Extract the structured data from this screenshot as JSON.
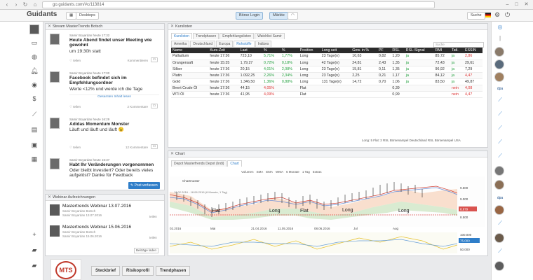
{
  "browser": {
    "url": "go.guidants.com/#c/113814"
  },
  "topbar": {
    "logo": "Guidants",
    "desktop_label": "Desktops",
    "btn_login": "Börse Login",
    "btn_market": "Märkte",
    "search": "Suche"
  },
  "stream": {
    "title": "Stream MasterTrends Botsch",
    "posts": [
      {
        "author": "Samir Boyardan",
        "time": "heute 17:32",
        "title": "Heute Abend findet unser Meeting wie gewohnt",
        "body": "um 19:30h statt",
        "like": "teilen",
        "comments": "Kommentieren"
      },
      {
        "author": "Samir Boyardan",
        "time": "heute 17:00",
        "title": "Facebook befindet sich im Empfehlungsordner",
        "body": "Werte <12% und werde ich die Tage",
        "read": "Gesamten Inhalt lesen",
        "like": "teilen",
        "comments": "2 Kommentare"
      },
      {
        "author": "Samir Boyardan",
        "time": "heute 16:29",
        "title": "Adidas Momentum Monster",
        "body": "Läuft und läuft und läuft 😉",
        "like": "teilen",
        "comments": "12 Kommentare"
      },
      {
        "author": "Samir Boyardan",
        "time": "heute 15:37",
        "title": "Habt Ihr Veränderungen vorgenommen",
        "body": "Oder bleibt investiert? Oder bereits vieles aufgelöst? Danke für Feedback",
        "read": "Gesamten Inhalt lesen",
        "action": "Post verfassen"
      }
    ]
  },
  "webinar": {
    "title": "Webinar Aufzeichnungen",
    "items": [
      {
        "title": "Mastertrends Webinar 13.07.2016",
        "sub1": "Samir Boyardan Botsch",
        "sub2": "Samir Boyardan 13.07.2016",
        "share": "teilen"
      },
      {
        "title": "Mastertrends Webinar 15.06.2016",
        "sub1": "Samir Boyardan Botsch",
        "sub2": "Samir Boyardan 15.06.2016",
        "share": "teilen"
      }
    ],
    "more": "Beiträge laden"
  },
  "kurslisten": {
    "title": "Kurslisten",
    "tabs": [
      "Kurslisten",
      "Trendphasen",
      "Empfehlungslisten",
      "Watchlist Samir"
    ],
    "subtabs": [
      "Amerika",
      "Deutschland",
      "Europa",
      "Rohstoffe",
      "Indizes"
    ],
    "search": "Suche",
    "columns": [
      "Name",
      "Kurs-Zeit",
      "Last",
      "%",
      "%",
      "Position",
      "Long seit",
      "Gew. in %",
      "PF",
      "RSL",
      "RSL-Signal",
      "RMI",
      "Tatl.",
      "ESSIN"
    ],
    "rows": [
      [
        "Palladium",
        "heute 17:36",
        "723,10",
        "5,71%",
        "1,77%",
        "Long",
        "23 Tage(n)",
        "10,63",
        "0,82",
        "1,20",
        "ja",
        "85,72",
        "ja",
        "2,86"
      ],
      [
        "Orangensaft",
        "heute 15:35",
        "1,79,27",
        "0,72%",
        "0,18%",
        "Long",
        "42 Tage(n)",
        "24,81",
        "2,43",
        "1,35",
        "ja",
        "72,43",
        "ja",
        "29,61"
      ],
      [
        "Silber",
        "heute 17:36",
        "20,15",
        "4,01%",
        "2,08%",
        "Long",
        "23 Tage(n)",
        "15,81",
        "0,11",
        "1,35",
        "ja",
        "96,92",
        "ja",
        "7,29"
      ],
      [
        "Platin",
        "heute 17:36",
        "1.092,25",
        "2,26%",
        "2,34%",
        "Long",
        "23 Tage(n)",
        "2,25",
        "0,21",
        "1,17",
        "ja",
        "84,12",
        "ja",
        "4,47"
      ],
      [
        "Gold",
        "heute 17:36",
        "1.346,50",
        "1,36%",
        "0,88%",
        "Long",
        "131 Tage(n)",
        "14,72",
        "0,70",
        "1,06",
        "ja",
        "83,50",
        "ja",
        "49,87"
      ],
      [
        "Brent Crude Öl",
        "heute 17:36",
        "44,15",
        "4,05%",
        "",
        "Flat",
        "",
        "",
        "",
        "0,39",
        "",
        "",
        "nein",
        "4,08"
      ],
      [
        "WTI Öl",
        "heute 17:36",
        "41,95",
        "4,09%",
        "",
        "Flat",
        "",
        "",
        "",
        "0,99",
        "",
        "",
        "nein",
        "4,47"
      ]
    ],
    "footer": "Long: 5  Flat: 2  RSL Börsenampel Deutschland  RSL Börsenampel USA"
  },
  "chart": {
    "title": "Chart",
    "tab_label": "Depot Masterfrends Depot (Indi)",
    "tab_chart": "Chart",
    "toolbar": [
      "Volumen",
      "SMA",
      "EMA",
      "WMA",
      "6 Monate",
      "1 Tag",
      "Extras"
    ],
    "legend": "Chartmuster",
    "legend2": "18.02.2016 - 18.08.2016 (6 Monate, 1 Tag)",
    "labels": [
      "Flat",
      "Long",
      "Flat",
      "Long",
      "Long"
    ],
    "dates": [
      "02.2016",
      "Mai",
      "21.04.2016",
      "11.05.2016",
      "08.06.2016",
      "Jul",
      "Aug"
    ],
    "yticks": [
      "9.500",
      "9.000",
      "8.679",
      "8.500"
    ],
    "osc_ticks": [
      "100.000",
      "75.000",
      "50.000"
    ]
  },
  "bottom": {
    "brand": "MTS",
    "buttons": [
      "Steckbrief",
      "Risikoprofil",
      "Trendphasen"
    ]
  }
}
